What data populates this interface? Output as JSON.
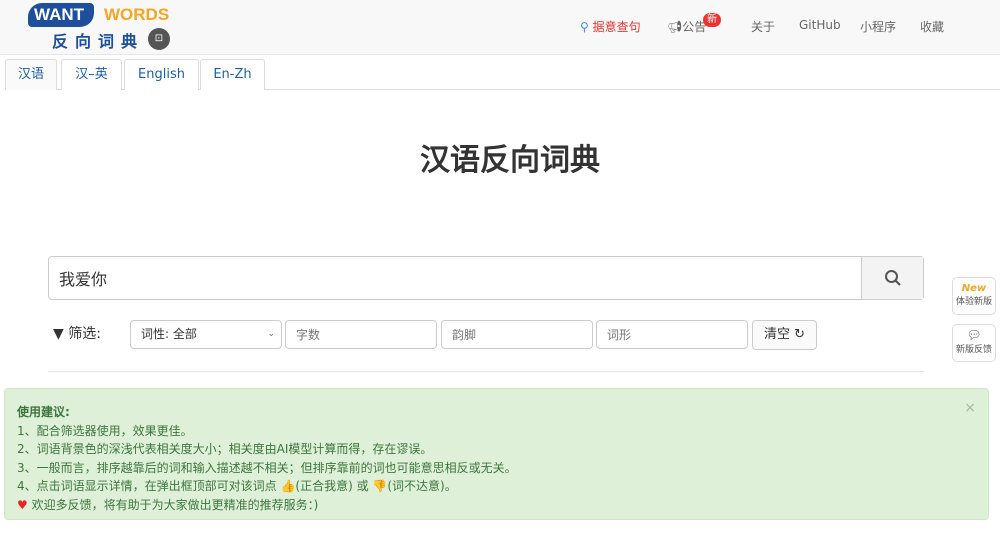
{
  "logo": {
    "want": "WANT",
    "words": "WORDS",
    "cn": "反向词典",
    "badge": "⊡"
  },
  "nav": {
    "search": "据意查句",
    "notice": "公告",
    "notice_badge": "新",
    "about": "关于",
    "github": "GitHub",
    "miniprogram": "小程序",
    "favorite": "收藏"
  },
  "tabs": [
    "汉语",
    "汉–英",
    "English",
    "En-Zh"
  ],
  "title": "汉语反向词典",
  "search": {
    "value": "我爱你"
  },
  "filter": {
    "label": "筛选:",
    "pos": "词性: 全部",
    "count_placeholder": "字数",
    "rhyme_placeholder": "韵脚",
    "form_placeholder": "词形",
    "clear": "清空"
  },
  "side": {
    "new_badge": "New",
    "try_new": "体验新版",
    "feedback": "新版反馈"
  },
  "tips": {
    "title": "使用建议:",
    "items": [
      "1、配合筛选器使用，效果更佳。",
      "2、词语背景色的深浅代表相关度大小；相关度由AI模型计算而得，存在谬误。",
      "3、一般而言，排序越靠后的词和输入描述越不相关；但排序靠前的词也可能意思相反或无关。",
      "4、点击词语显示详情，在弹出框顶部可对该词点 👍(正合我意) 或 👎(词不达意)。"
    ],
    "footer": "欢迎多反馈，将有助于为大家做出更精准的推荐服务：)",
    "close": "×"
  },
  "colors": {
    "brand": "#1d4f9c",
    "accent": "#f5a623",
    "alert_bg": "#dff0d8",
    "alert_text": "#3c763d",
    "active_nav": "#e33"
  }
}
